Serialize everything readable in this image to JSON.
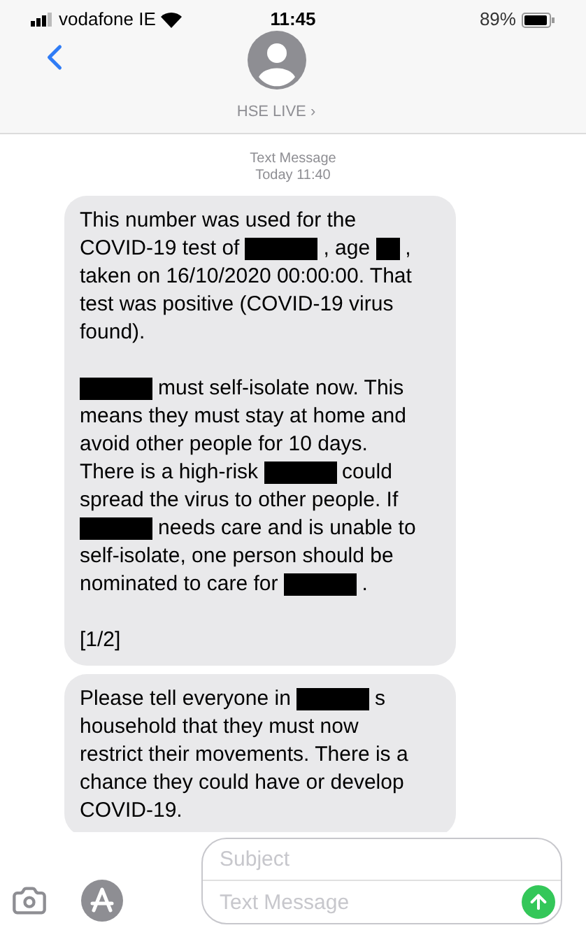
{
  "status_bar": {
    "carrier": "vodafone IE",
    "time": "11:45",
    "battery": "89%"
  },
  "contact": {
    "name": "HSE LIVE ›"
  },
  "thread_header": {
    "service": "Text Message",
    "timestamp": "Today 11:40"
  },
  "messages": [
    {
      "paragraphs": [
        {
          "lines": [
            [
              {
                "kind": "text",
                "text": "This number was used for the"
              }
            ],
            [
              {
                "kind": "text",
                "text": "COVID-19 test of"
              },
              {
                "kind": "redaction"
              },
              {
                "kind": "text",
                "text": ", age"
              },
              {
                "kind": "short_redaction"
              },
              {
                "kind": "text",
                "text": ","
              }
            ],
            [
              {
                "kind": "text",
                "text": "taken on 16/10/2020 00:00:00. That"
              }
            ],
            [
              {
                "kind": "text",
                "text": "test was positive (COVID-19 virus"
              }
            ],
            [
              {
                "kind": "text",
                "text": "found)."
              }
            ]
          ]
        },
        {
          "lines": [
            [
              {
                "kind": "redaction"
              },
              {
                "kind": "text",
                "text": "must self-isolate now. This"
              }
            ],
            [
              {
                "kind": "text",
                "text": "means they must stay at home and"
              }
            ],
            [
              {
                "kind": "text",
                "text": "avoid other people for 10 days."
              }
            ],
            [
              {
                "kind": "text",
                "text": "There is a high-risk"
              },
              {
                "kind": "redaction"
              },
              {
                "kind": "text",
                "text": "could"
              }
            ],
            [
              {
                "kind": "text",
                "text": "spread the virus to other people. If"
              }
            ],
            [
              {
                "kind": "redaction"
              },
              {
                "kind": "text",
                "text": "needs care and is unable to"
              }
            ],
            [
              {
                "kind": "text",
                "text": "self-isolate, one person should be"
              }
            ],
            [
              {
                "kind": "text",
                "text": "nominated to care for"
              },
              {
                "kind": "redaction"
              },
              {
                "kind": "text",
                "text": "."
              }
            ]
          ]
        },
        {
          "lines": [
            [
              {
                "kind": "text",
                "text": "[1/2]"
              }
            ]
          ]
        }
      ]
    },
    {
      "paragraphs": [
        {
          "lines": [
            [
              {
                "kind": "text",
                "text": "Please tell everyone in"
              },
              {
                "kind": "redaction"
              },
              {
                "kind": "text",
                "text": "s"
              }
            ],
            [
              {
                "kind": "text",
                "text": "household that they must now"
              }
            ],
            [
              {
                "kind": "text",
                "text": "restrict their movements. There is a"
              }
            ],
            [
              {
                "kind": "text",
                "text": "chance they could have or develop"
              }
            ],
            [
              {
                "kind": "text",
                "text": "COVID-19."
              }
            ]
          ]
        }
      ]
    }
  ],
  "composer": {
    "subject_placeholder": "Subject",
    "message_placeholder": "Text Message"
  }
}
